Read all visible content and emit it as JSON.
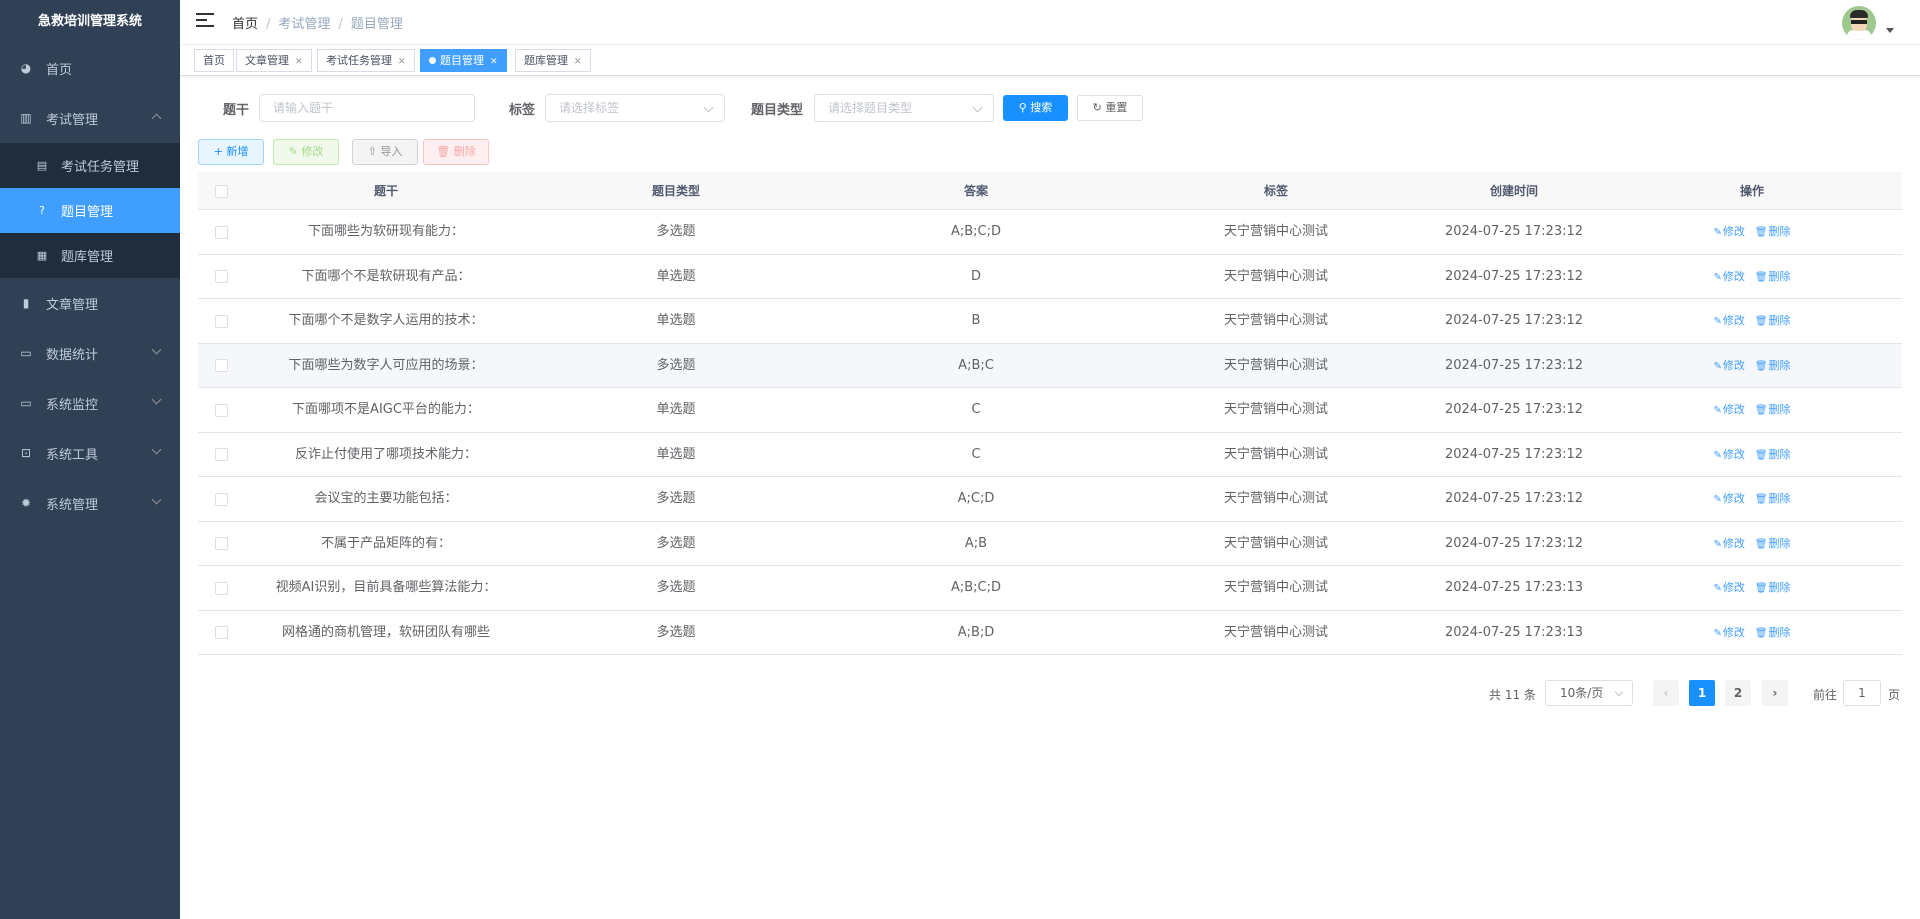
{
  "app": {
    "title": "急救培训管理系统"
  },
  "sidebar": {
    "items": [
      {
        "label": "首页",
        "icon": "dashboard-icon"
      },
      {
        "label": "考试管理",
        "icon": "exam-icon",
        "expanded": true,
        "children": [
          {
            "label": "考试任务管理",
            "icon": "calendar-icon"
          },
          {
            "label": "题目管理",
            "icon": "question-icon",
            "active": true
          },
          {
            "label": "题库管理",
            "icon": "bank-icon"
          }
        ]
      },
      {
        "label": "文章管理",
        "icon": "article-icon"
      },
      {
        "label": "数据统计",
        "icon": "chart-icon"
      },
      {
        "label": "系统监控",
        "icon": "monitor-icon"
      },
      {
        "label": "系统工具",
        "icon": "tool-icon"
      },
      {
        "label": "系统管理",
        "icon": "gear-icon"
      }
    ]
  },
  "breadcrumb": [
    "首页",
    "考试管理",
    "题目管理"
  ],
  "tags": [
    {
      "label": "首页"
    },
    {
      "label": "文章管理",
      "closable": true
    },
    {
      "label": "考试任务管理",
      "closable": true
    },
    {
      "label": "题目管理",
      "closable": true,
      "active": true
    },
    {
      "label": "题库管理",
      "closable": true
    }
  ],
  "search": {
    "stem_label": "题干",
    "stem_placeholder": "请输入题干",
    "tag_label": "标签",
    "tag_placeholder": "请选择标签",
    "type_label": "题目类型",
    "type_placeholder": "请选择题目类型",
    "search_btn": "搜索",
    "reset_btn": "重置"
  },
  "toolbar": {
    "add": "新增",
    "edit": "修改",
    "import": "导入",
    "delete": "删除"
  },
  "table": {
    "headers": [
      "题干",
      "题目类型",
      "答案",
      "标签",
      "创建时间",
      "操作"
    ],
    "op_edit": "修改",
    "op_delete": "删除",
    "rows": [
      {
        "stem": "下面哪些为软研现有能力：",
        "type": "多选题",
        "answer": "A;B;C;D",
        "tag": "天宁营销中心测试",
        "time": "2024-07-25 17:23:12"
      },
      {
        "stem": "下面哪个不是软研现有产品：",
        "type": "单选题",
        "answer": "D",
        "tag": "天宁营销中心测试",
        "time": "2024-07-25 17:23:12"
      },
      {
        "stem": "下面哪个不是数字人运用的技术：",
        "type": "单选题",
        "answer": "B",
        "tag": "天宁营销中心测试",
        "time": "2024-07-25 17:23:12"
      },
      {
        "stem": "下面哪些为数字人可应用的场景：",
        "type": "多选题",
        "answer": "A;B;C",
        "tag": "天宁营销中心测试",
        "time": "2024-07-25 17:23:12"
      },
      {
        "stem": "下面哪项不是AIGC平台的能力：",
        "type": "单选题",
        "answer": "C",
        "tag": "天宁营销中心测试",
        "time": "2024-07-25 17:23:12"
      },
      {
        "stem": "反诈止付使用了哪项技术能力：",
        "type": "单选题",
        "answer": "C",
        "tag": "天宁营销中心测试",
        "time": "2024-07-25 17:23:12"
      },
      {
        "stem": "会议宝的主要功能包括：",
        "type": "多选题",
        "answer": "A;C;D",
        "tag": "天宁营销中心测试",
        "time": "2024-07-25 17:23:12"
      },
      {
        "stem": "不属于产品矩阵的有：",
        "type": "多选题",
        "answer": "A;B",
        "tag": "天宁营销中心测试",
        "time": "2024-07-25 17:23:12"
      },
      {
        "stem": "视频AI识别，目前具备哪些算法能力：",
        "type": "多选题",
        "answer": "A;B;C;D",
        "tag": "天宁营销中心测试",
        "time": "2024-07-25 17:23:13"
      },
      {
        "stem": "网格通的商机管理，软研团队有哪些",
        "type": "多选题",
        "answer": "A;B;D",
        "tag": "天宁营销中心测试",
        "time": "2024-07-25 17:23:13"
      }
    ]
  },
  "pagination": {
    "total_text": "共 11 条",
    "page_size": "10条/页",
    "pages": [
      "1",
      "2"
    ],
    "current": 1,
    "jump_label": "前往",
    "jump_value": "1",
    "jump_unit": "页"
  },
  "colors": {
    "primary": "#1890ff",
    "sidebar_bg": "#304156",
    "active_menu": "#409eff"
  }
}
